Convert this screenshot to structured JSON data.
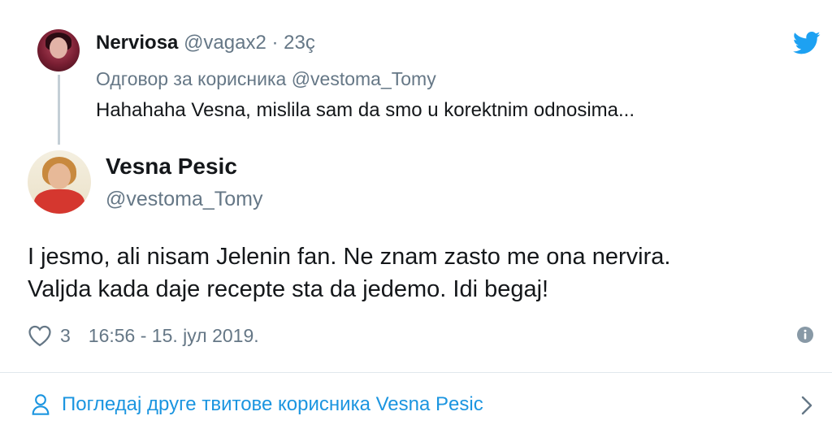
{
  "parent_tweet": {
    "author_name": "Nerviosa",
    "author_handle": "@vagax2",
    "separator": "·",
    "time_ago": "23ç",
    "reply_to": "Одговор за корисника @vestoma_Tomy",
    "text": "Hahahaha Vesna, mislila sam da smo u korektnim  odnosima..."
  },
  "main_tweet": {
    "author_name": "Vesna Pesic",
    "author_handle": "@vestoma_Tomy",
    "text_lines": [
      "I jesmo, ali nisam Jelenin fan. Ne znam zasto me ona nervira.",
      "Valjda kada daje recepte sta da jedemo. Idi begaj!"
    ],
    "like_count": "3",
    "timestamp": "16:56 - 15. јул 2019."
  },
  "footer": {
    "more_tweets_label": "Погледај друге твитове корисника Vesna Pesic"
  },
  "icons": {
    "brand": "twitter-bird-icon",
    "like": "heart-icon",
    "info": "info-icon",
    "profile": "person-icon",
    "arrow": "chevron-right-icon"
  },
  "colors": {
    "twitter_blue": "#1da1f2",
    "link_blue": "#1b95e0",
    "secondary_text": "#657786",
    "primary_text": "#14171a"
  }
}
